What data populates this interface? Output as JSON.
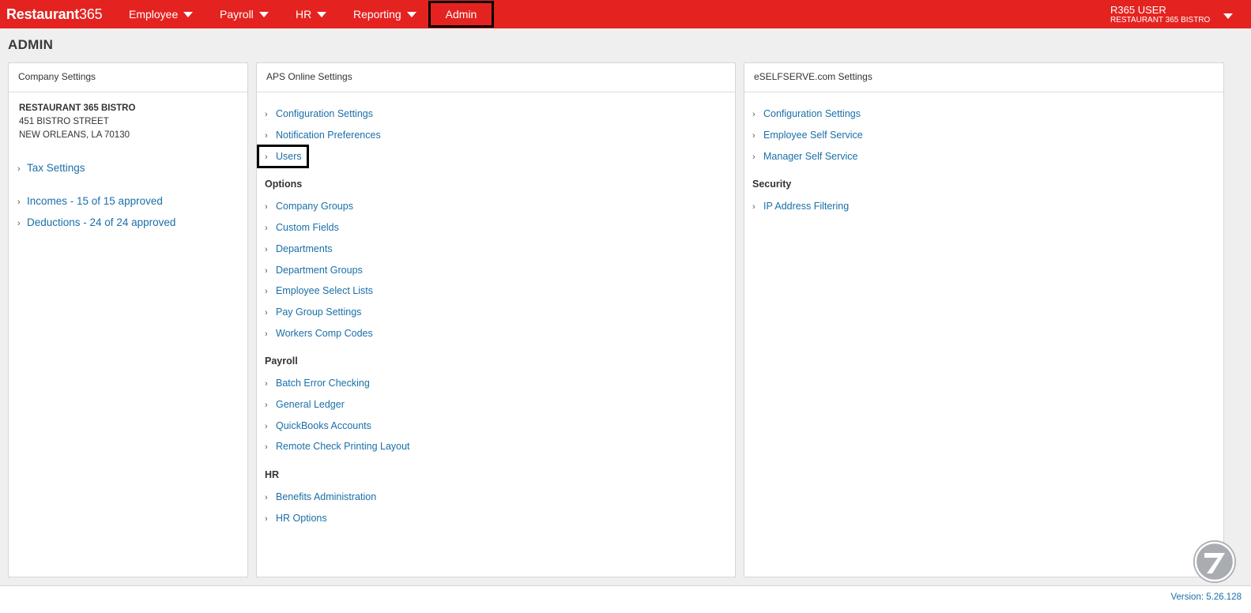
{
  "brand": {
    "bold": "Restaurant",
    "light": "365"
  },
  "nav": {
    "employee": "Employee",
    "payroll": "Payroll",
    "hr": "HR",
    "reporting": "Reporting",
    "admin": "Admin"
  },
  "user": {
    "name": "R365 USER",
    "company": "RESTAURANT 365 BISTRO"
  },
  "page_title": "ADMIN",
  "company_panel": {
    "header": "Company Settings",
    "company_name": "RESTAURANT 365 BISTRO",
    "address_line1": "451 BISTRO STREET",
    "address_line2": "NEW ORLEANS, LA 70130",
    "links": [
      "Tax Settings",
      "Incomes - 15 of 15 approved",
      "Deductions - 24 of 24 approved"
    ]
  },
  "aps_panel": {
    "header": "APS Online Settings",
    "general": [
      "Configuration Settings",
      "Notification Preferences",
      "Users"
    ],
    "options_label": "Options",
    "options": [
      "Company Groups",
      "Custom Fields",
      "Departments",
      "Department Groups",
      "Employee Select Lists",
      "Pay Group Settings",
      "Workers Comp Codes"
    ],
    "payroll_label": "Payroll",
    "payroll": [
      "Batch Error Checking",
      "General Ledger",
      "QuickBooks Accounts",
      "Remote Check Printing Layout"
    ],
    "hr_label": "HR",
    "hr": [
      "Benefits Administration",
      "HR Options"
    ]
  },
  "eself_panel": {
    "header": "eSELFSERVE.com Settings",
    "general": [
      "Configuration Settings",
      "Employee Self Service",
      "Manager Self Service"
    ],
    "security_label": "Security",
    "security": [
      "IP Address Filtering"
    ]
  },
  "icons": {
    "chevron": "chevron-right-icon",
    "caret": "caret-down-icon"
  },
  "colors": {
    "brand_red": "#e42320",
    "link_blue": "#1a6fa8"
  },
  "version": "Version: 5.26.128"
}
